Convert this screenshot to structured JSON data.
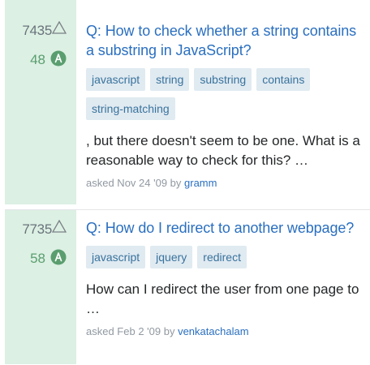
{
  "results": [
    {
      "score": "7435",
      "answers": "48",
      "title": "Q: How to check whether a string contains a substring in JavaScript?",
      "tags": [
        "javascript",
        "string",
        "substring",
        "contains",
        "string-matching"
      ],
      "excerpt": ", but there doesn't seem to be one. What is a reasonable way to check for this? …",
      "asked_prefix": "asked Nov 24 '09 by",
      "user": "gramm"
    },
    {
      "score": "7735",
      "answers": "58",
      "title": "Q: How do I redirect to another webpage?",
      "tags": [
        "javascript",
        "jquery",
        "redirect"
      ],
      "excerpt": "How can I redirect the user from one page to …",
      "asked_prefix": "asked Feb 2 '09 by",
      "user": "venkatachalam"
    }
  ],
  "icons": {
    "vote": "upvote-icon",
    "answer": "answer-badge-icon"
  },
  "colors": {
    "answered_bg": "#dcf0e3",
    "link": "#2a6fc0",
    "tag_bg": "#e0eaf1",
    "tag_text": "#39739d"
  }
}
